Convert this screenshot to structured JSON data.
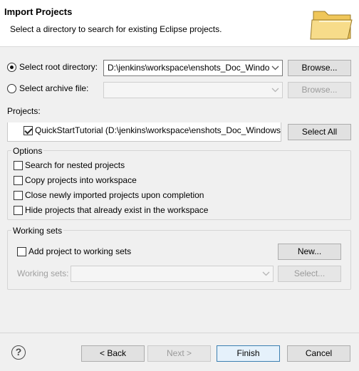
{
  "header": {
    "title": "Import Projects",
    "description": "Select a directory to search for existing Eclipse projects.",
    "icon": "folder-icon"
  },
  "source": {
    "root_directory_label": "Select root directory:",
    "root_directory_value": "D:\\jenkins\\workspace\\enshots_Doc_Windo",
    "root_selected": true,
    "archive_file_label": "Select archive file:",
    "archive_file_value": "",
    "browse_label": "Browse..."
  },
  "projects": {
    "label": "Projects:",
    "items": [
      {
        "label": "QuickStartTutorial (D:\\jenkins\\workspace\\enshots_Doc_Windows",
        "checked": true
      }
    ],
    "select_all_label": "Select All"
  },
  "options": {
    "title": "Options",
    "items": [
      {
        "label": "Search for nested projects",
        "checked": false
      },
      {
        "label": "Copy projects into workspace",
        "checked": false
      },
      {
        "label": "Close newly imported projects upon completion",
        "checked": false
      },
      {
        "label": "Hide projects that already exist in the workspace",
        "checked": false
      }
    ]
  },
  "working_sets": {
    "title": "Working sets",
    "add_label": "Add project to working sets",
    "add_checked": false,
    "new_label": "New...",
    "sets_label": "Working sets:",
    "sets_value": "",
    "select_label": "Select..."
  },
  "footer": {
    "help_symbol": "?",
    "back_label": "< Back",
    "next_label": "Next >",
    "finish_label": "Finish",
    "cancel_label": "Cancel"
  },
  "colors": {
    "background": "#f0f0f0",
    "header_background": "#ffffff",
    "folder_icon": "#f4d47a",
    "primary_button_border": "#3c7fb1"
  }
}
